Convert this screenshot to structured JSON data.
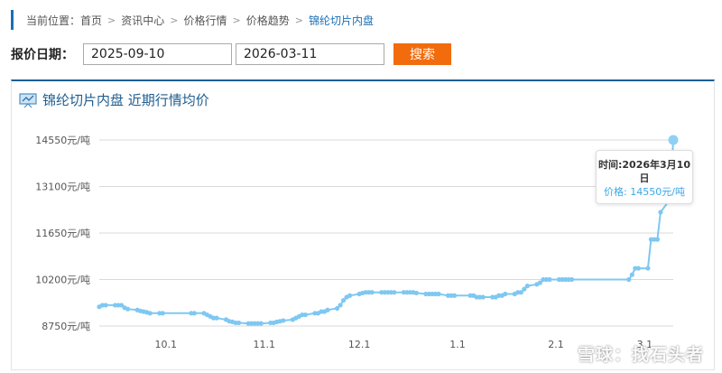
{
  "breadcrumb": {
    "items": [
      "当前位置：",
      "首页",
      "资讯中心",
      "价格行情",
      "价格趋势",
      "锦纶切片内盘"
    ]
  },
  "search": {
    "date_label": "报价日期：",
    "start_date": "2025-09-10",
    "end_date": "2026-03-11",
    "button_label": "搜索"
  },
  "panel": {
    "title": "锦纶切片内盘 近期行情均价"
  },
  "tooltip": {
    "time": "时间:2026年3月10日",
    "price": "价格: 14550元/吨"
  },
  "watermark_text": "雪球：找石头者",
  "colors": {
    "accent": "#1a6fb5",
    "button": "#f26c0d",
    "line": "#7ec8f2"
  },
  "chart_data": {
    "type": "line",
    "title": "锦纶切片内盘 近期行情均价",
    "xlabel": "",
    "ylabel": "",
    "y_ticks": [
      8750,
      10200,
      11650,
      13100,
      14550
    ],
    "y_tick_suffix": "元/吨",
    "ylim": [
      8750,
      14550
    ],
    "x_tick_labels": [
      {
        "label": "10.1",
        "x": "2025-10-01"
      },
      {
        "label": "11.1",
        "x": "2025-11-01"
      },
      {
        "label": "12.1",
        "x": "2025-12-01"
      },
      {
        "label": "1.1",
        "x": "2026-01-01"
      },
      {
        "label": "2.1",
        "x": "2026-02-01"
      },
      {
        "label": "3.1",
        "x": "2026-03-01"
      }
    ],
    "xlim": [
      "2025-09-10",
      "2026-03-10"
    ],
    "grid": true,
    "series": [
      {
        "points": [
          {
            "x": "2025-09-10",
            "y": 9350
          },
          {
            "x": "2025-09-11",
            "y": 9400
          },
          {
            "x": "2025-09-12",
            "y": 9400
          },
          {
            "x": "2025-09-15",
            "y": 9400
          },
          {
            "x": "2025-09-16",
            "y": 9400
          },
          {
            "x": "2025-09-17",
            "y": 9400
          },
          {
            "x": "2025-09-18",
            "y": 9320
          },
          {
            "x": "2025-09-19",
            "y": 9280
          },
          {
            "x": "2025-09-22",
            "y": 9250
          },
          {
            "x": "2025-09-23",
            "y": 9220
          },
          {
            "x": "2025-09-24",
            "y": 9200
          },
          {
            "x": "2025-09-25",
            "y": 9180
          },
          {
            "x": "2025-09-26",
            "y": 9150
          },
          {
            "x": "2025-09-29",
            "y": 9150
          },
          {
            "x": "2025-09-30",
            "y": 9150
          },
          {
            "x": "2025-10-09",
            "y": 9150
          },
          {
            "x": "2025-10-10",
            "y": 9150
          },
          {
            "x": "2025-10-13",
            "y": 9150
          },
          {
            "x": "2025-10-14",
            "y": 9100
          },
          {
            "x": "2025-10-15",
            "y": 9050
          },
          {
            "x": "2025-10-16",
            "y": 9000
          },
          {
            "x": "2025-10-17",
            "y": 9000
          },
          {
            "x": "2025-10-20",
            "y": 8950
          },
          {
            "x": "2025-10-21",
            "y": 8900
          },
          {
            "x": "2025-10-22",
            "y": 8880
          },
          {
            "x": "2025-10-23",
            "y": 8850
          },
          {
            "x": "2025-10-24",
            "y": 8850
          },
          {
            "x": "2025-10-27",
            "y": 8830
          },
          {
            "x": "2025-10-28",
            "y": 8830
          },
          {
            "x": "2025-10-29",
            "y": 8830
          },
          {
            "x": "2025-10-30",
            "y": 8830
          },
          {
            "x": "2025-10-31",
            "y": 8830
          },
          {
            "x": "2025-11-03",
            "y": 8850
          },
          {
            "x": "2025-11-04",
            "y": 8850
          },
          {
            "x": "2025-11-05",
            "y": 8880
          },
          {
            "x": "2025-11-06",
            "y": 8900
          },
          {
            "x": "2025-11-07",
            "y": 8920
          },
          {
            "x": "2025-11-10",
            "y": 8950
          },
          {
            "x": "2025-11-11",
            "y": 9000
          },
          {
            "x": "2025-11-12",
            "y": 9050
          },
          {
            "x": "2025-11-13",
            "y": 9100
          },
          {
            "x": "2025-11-14",
            "y": 9100
          },
          {
            "x": "2025-11-17",
            "y": 9150
          },
          {
            "x": "2025-11-18",
            "y": 9150
          },
          {
            "x": "2025-11-19",
            "y": 9200
          },
          {
            "x": "2025-11-20",
            "y": 9200
          },
          {
            "x": "2025-11-21",
            "y": 9250
          },
          {
            "x": "2025-11-24",
            "y": 9300
          },
          {
            "x": "2025-11-25",
            "y": 9400
          },
          {
            "x": "2025-11-26",
            "y": 9550
          },
          {
            "x": "2025-11-27",
            "y": 9650
          },
          {
            "x": "2025-11-28",
            "y": 9700
          },
          {
            "x": "2025-12-01",
            "y": 9750
          },
          {
            "x": "2025-12-02",
            "y": 9780
          },
          {
            "x": "2025-12-03",
            "y": 9800
          },
          {
            "x": "2025-12-04",
            "y": 9800
          },
          {
            "x": "2025-12-05",
            "y": 9800
          },
          {
            "x": "2025-12-08",
            "y": 9800
          },
          {
            "x": "2025-12-09",
            "y": 9800
          },
          {
            "x": "2025-12-10",
            "y": 9800
          },
          {
            "x": "2025-12-11",
            "y": 9800
          },
          {
            "x": "2025-12-12",
            "y": 9800
          },
          {
            "x": "2025-12-15",
            "y": 9800
          },
          {
            "x": "2025-12-16",
            "y": 9800
          },
          {
            "x": "2025-12-17",
            "y": 9800
          },
          {
            "x": "2025-12-18",
            "y": 9800
          },
          {
            "x": "2025-12-19",
            "y": 9780
          },
          {
            "x": "2025-12-22",
            "y": 9750
          },
          {
            "x": "2025-12-23",
            "y": 9750
          },
          {
            "x": "2025-12-24",
            "y": 9750
          },
          {
            "x": "2025-12-25",
            "y": 9750
          },
          {
            "x": "2025-12-26",
            "y": 9750
          },
          {
            "x": "2025-12-29",
            "y": 9700
          },
          {
            "x": "2025-12-30",
            "y": 9700
          },
          {
            "x": "2025-12-31",
            "y": 9700
          },
          {
            "x": "2026-01-05",
            "y": 9700
          },
          {
            "x": "2026-01-06",
            "y": 9700
          },
          {
            "x": "2026-01-07",
            "y": 9650
          },
          {
            "x": "2026-01-08",
            "y": 9650
          },
          {
            "x": "2026-01-09",
            "y": 9650
          },
          {
            "x": "2026-01-12",
            "y": 9650
          },
          {
            "x": "2026-01-13",
            "y": 9650
          },
          {
            "x": "2026-01-14",
            "y": 9700
          },
          {
            "x": "2026-01-15",
            "y": 9700
          },
          {
            "x": "2026-01-16",
            "y": 9750
          },
          {
            "x": "2026-01-19",
            "y": 9750
          },
          {
            "x": "2026-01-20",
            "y": 9800
          },
          {
            "x": "2026-01-21",
            "y": 9800
          },
          {
            "x": "2026-01-22",
            "y": 9900
          },
          {
            "x": "2026-01-23",
            "y": 10000
          },
          {
            "x": "2026-01-26",
            "y": 10050
          },
          {
            "x": "2026-01-27",
            "y": 10100
          },
          {
            "x": "2026-01-28",
            "y": 10200
          },
          {
            "x": "2026-01-29",
            "y": 10200
          },
          {
            "x": "2026-01-30",
            "y": 10200
          },
          {
            "x": "2026-02-02",
            "y": 10200
          },
          {
            "x": "2026-02-03",
            "y": 10200
          },
          {
            "x": "2026-02-04",
            "y": 10200
          },
          {
            "x": "2026-02-05",
            "y": 10200
          },
          {
            "x": "2026-02-06",
            "y": 10200
          },
          {
            "x": "2026-02-24",
            "y": 10200
          },
          {
            "x": "2026-02-25",
            "y": 10350
          },
          {
            "x": "2026-02-26",
            "y": 10550
          },
          {
            "x": "2026-02-27",
            "y": 10550
          },
          {
            "x": "2026-03-02",
            "y": 10550
          },
          {
            "x": "2026-03-03",
            "y": 11450
          },
          {
            "x": "2026-03-04",
            "y": 11450
          },
          {
            "x": "2026-03-05",
            "y": 11450
          },
          {
            "x": "2026-03-06",
            "y": 12300
          },
          {
            "x": "2026-03-09",
            "y": 12700
          },
          {
            "x": "2026-03-10",
            "y": 14550
          }
        ]
      }
    ],
    "highlight_point": {
      "x": "2026-03-10",
      "y": 14550
    }
  }
}
